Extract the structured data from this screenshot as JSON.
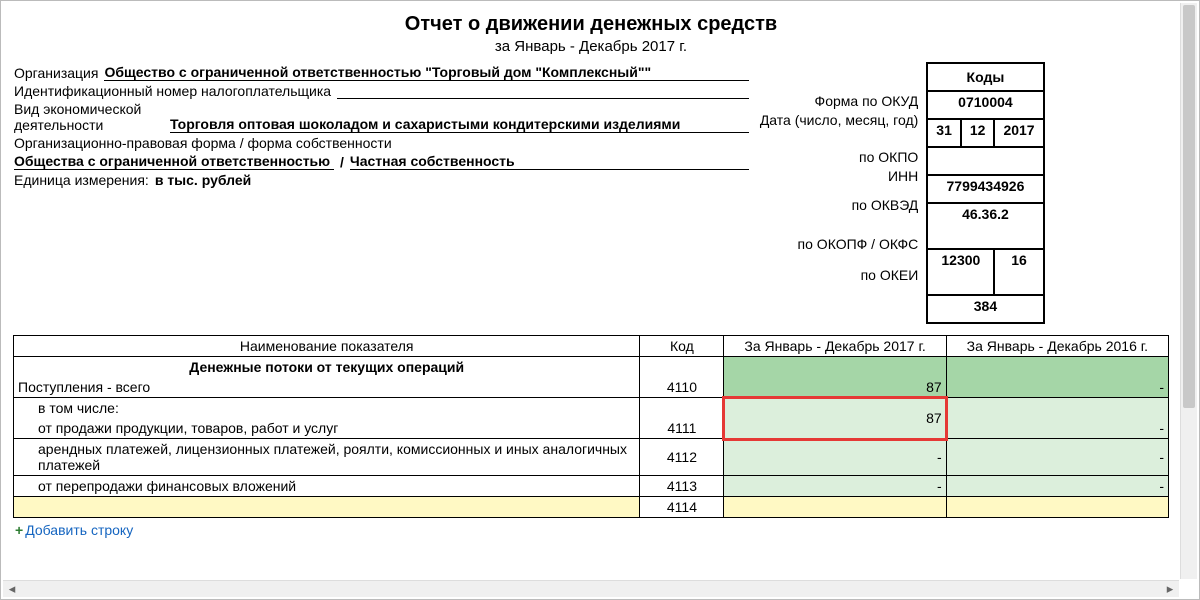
{
  "title": "Отчет о движении денежных средств",
  "subtitle": "за Январь - Декабрь 2017 г.",
  "codes": {
    "header": "Коды",
    "form_okud_label": "Форма по ОКУД",
    "form_okud": "0710004",
    "date_label": "Дата (число, месяц, год)",
    "date_day": "31",
    "date_month": "12",
    "date_year": "2017",
    "okpo_label": "по ОКПО",
    "okpo": "",
    "inn_label": "ИНН",
    "inn": "7799434926",
    "okved_label": "по ОКВЭД",
    "okved": "46.36.2",
    "okopf_label": "по ОКОПФ / ОКФС",
    "okopf": "12300",
    "okfs": "16",
    "okei_label": "по ОКЕИ",
    "okei": "384"
  },
  "org": {
    "label": "Организация",
    "value": "Общество с ограниченной ответственностью \"Торговый дом \"Комплексный\"\""
  },
  "taxid": {
    "label": "Идентификационный номер налогоплательщика",
    "value": ""
  },
  "activity": {
    "label": "Вид экономической деятельности",
    "value": "Торговля оптовая шоколадом и сахаристыми кондитерскими изделиями"
  },
  "legal": {
    "label": "Организационно-правовая форма / форма собственности",
    "value1": "Общества с ограниченной ответственностью",
    "slash": "/",
    "value2": "Частная собственность"
  },
  "unit": {
    "label": "Единица измерения:",
    "value": "в тыс. рублей"
  },
  "table": {
    "head_name": "Наименование показателя",
    "head_code": "Код",
    "head_p1": "За Январь - Декабрь 2017 г.",
    "head_p2": "За Январь - Декабрь 2016 г.",
    "section": "Денежные потоки от текущих операций",
    "rows": [
      {
        "name": "Поступления - всего",
        "code": "4110",
        "p1": "87",
        "p2": "-"
      },
      {
        "name": "в том числе:",
        "code": "",
        "p1": "",
        "p2": ""
      },
      {
        "name": "от продажи продукции, товаров, работ и услуг",
        "code": "4111",
        "p1": "87",
        "p2": "-"
      },
      {
        "name": "арендных платежей, лицензионных платежей, роялти, комиссионных и иных аналогичных платежей",
        "code": "4112",
        "p1": "-",
        "p2": "-"
      },
      {
        "name": "от перепродажи финансовых вложений",
        "code": "4113",
        "p1": "-",
        "p2": "-"
      },
      {
        "name": "",
        "code": "4114",
        "p1": "",
        "p2": ""
      }
    ]
  },
  "add_row": "Добавить строку",
  "hscroll_left": "◂",
  "hscroll_right": "▸"
}
